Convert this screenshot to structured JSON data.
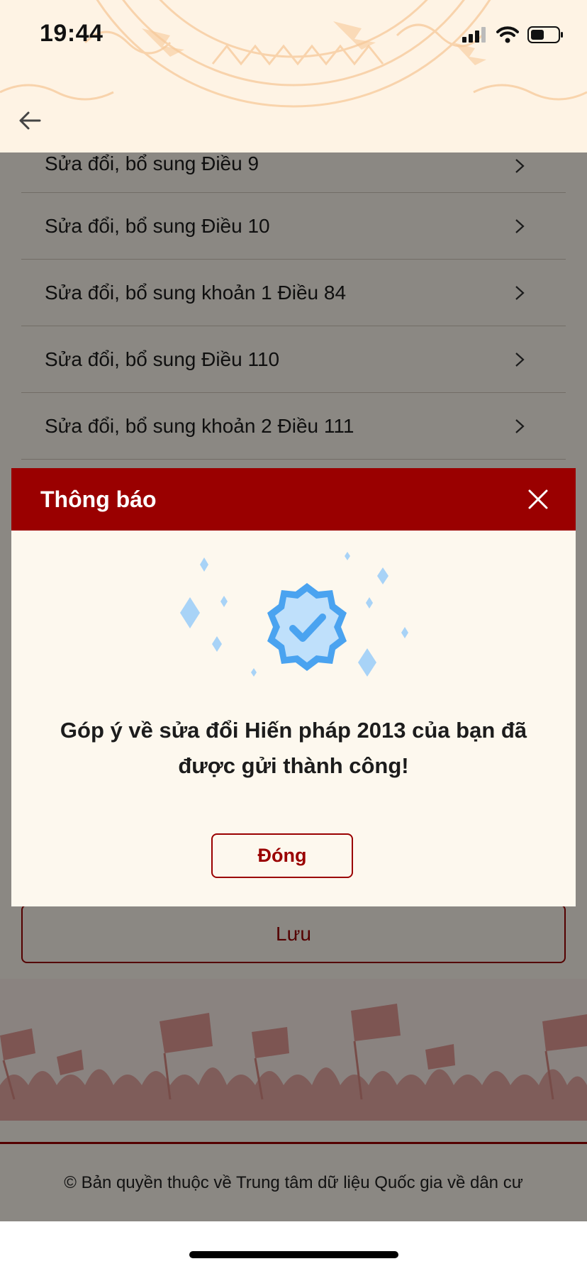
{
  "status_bar": {
    "time": "19:44"
  },
  "header": {
    "back_icon": "arrow-left-icon"
  },
  "list": {
    "items": [
      {
        "label": "Sửa đổi, bổ sung Điều 9"
      },
      {
        "label": "Sửa đổi, bổ sung Điều 10"
      },
      {
        "label": "Sửa đổi, bổ sung khoản 1 Điều 84"
      },
      {
        "label": "Sửa đổi, bổ sung Điều 110"
      },
      {
        "label": "Sửa đổi, bổ sung khoản 2 Điều 111"
      }
    ]
  },
  "save_button": {
    "label": "Lưu"
  },
  "footer": {
    "copyright": "© Bản quyền thuộc về Trung tâm dữ liệu Quốc gia về dân cư"
  },
  "dialog": {
    "title": "Thông báo",
    "message_line1": "Góp ý về sửa đổi Hiến pháp 2013 của bạn đã",
    "message_line2": "được gửi thành công!",
    "close_button_label": "Đóng",
    "icon": "verified-badge-icon"
  },
  "colors": {
    "primary": "#9a0000",
    "background": "#fdf8ee",
    "badge": "#4aa3f0"
  }
}
